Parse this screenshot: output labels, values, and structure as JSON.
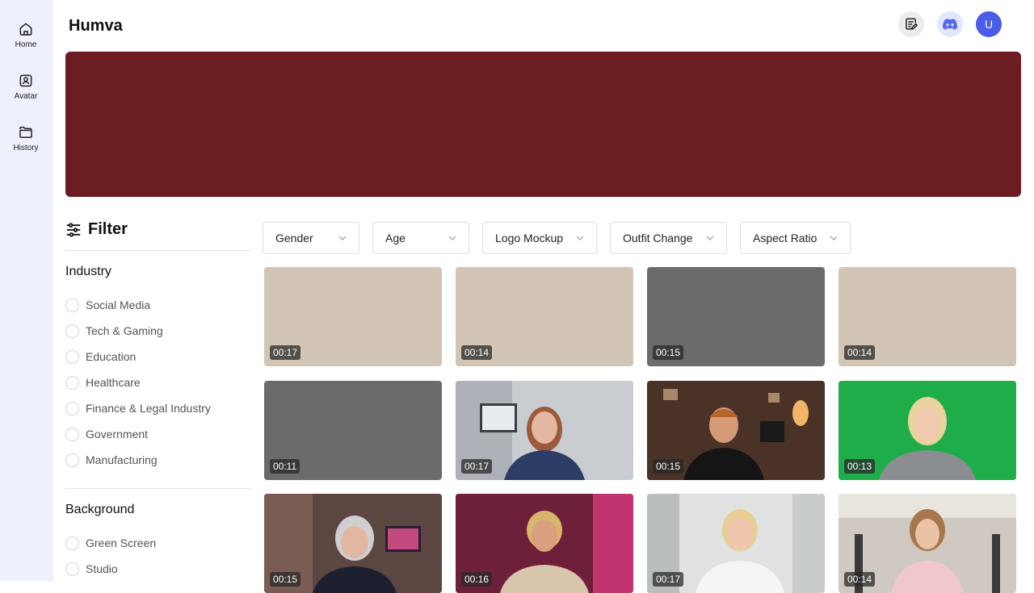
{
  "app": {
    "title": "Humva",
    "user_initial": "U"
  },
  "sidebar": {
    "items": [
      {
        "label": "Home",
        "icon": "home-icon"
      },
      {
        "label": "Avatar",
        "icon": "avatar-icon"
      },
      {
        "label": "History",
        "icon": "folder-icon"
      }
    ]
  },
  "header": {
    "icons": [
      "notes-icon",
      "discord-icon",
      "user-avatar"
    ]
  },
  "filter": {
    "title": "Filter",
    "industry": {
      "title": "Industry",
      "options": [
        "Social Media",
        "Tech & Gaming",
        "Education",
        "Healthcare",
        "Finance & Legal Industry",
        "Government",
        "Manufacturing"
      ]
    },
    "background": {
      "title": "Background",
      "options": [
        "Green Screen",
        "Studio"
      ]
    }
  },
  "dropdowns": [
    "Gender",
    "Age",
    "Logo Mockup",
    "Outfit Change",
    "Aspect Ratio"
  ],
  "videos": [
    {
      "duration": "00:17",
      "bg": "#d2c5b6"
    },
    {
      "duration": "00:14",
      "bg": "#d2c5b6"
    },
    {
      "duration": "00:15",
      "bg": "#6b6b6b"
    },
    {
      "duration": "00:14",
      "bg": "#d2c5b6"
    },
    {
      "duration": "00:11",
      "bg": "#6b6b6b"
    },
    {
      "duration": "00:17",
      "bg": "#b9bcc3"
    },
    {
      "duration": "00:15",
      "bg": "#5a3b2a"
    },
    {
      "duration": "00:13",
      "bg": "#22a94a"
    },
    {
      "duration": "00:15",
      "bg": "#6e5550"
    },
    {
      "duration": "00:16",
      "bg": "#7a2440"
    },
    {
      "duration": "00:17",
      "bg": "#d9dcd9"
    },
    {
      "duration": "00:14",
      "bg": "#c9c3bb"
    }
  ],
  "colors": {
    "banner": "#6b1d21",
    "sidebar": "#eef0fb",
    "avatar": "#4a5ce8",
    "discord": "#5865f2"
  }
}
